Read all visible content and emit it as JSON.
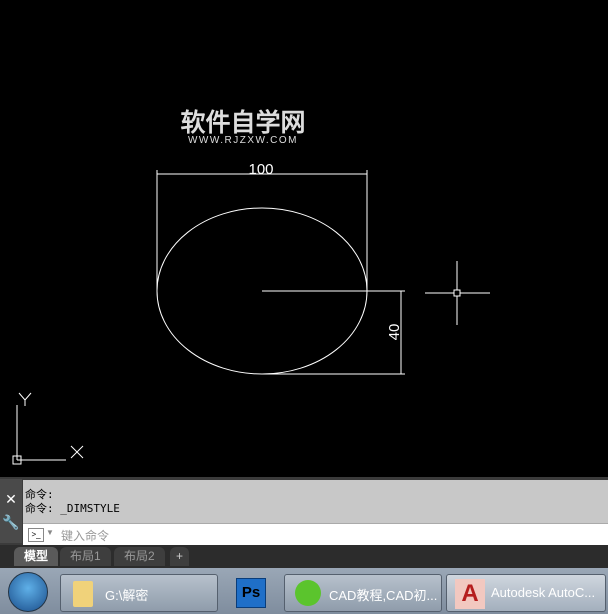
{
  "drawing": {
    "watermark_title": "软件自学网",
    "watermark_url": "WWW.RJZXW.COM",
    "dim_horizontal": "100",
    "dim_vertical": "40",
    "ucs_x": "X",
    "ucs_y": "Y"
  },
  "command": {
    "history": [
      "命令:",
      "命令: _DIMSTYLE"
    ],
    "placeholder": "键入命令"
  },
  "tabs": [
    {
      "label": "模型",
      "active": true
    },
    {
      "label": "布局1"
    },
    {
      "label": "布局2"
    },
    {
      "label": "+"
    }
  ],
  "taskbar": {
    "items": [
      {
        "label": "G:\\解密",
        "icon": "folder-icon"
      },
      {
        "label": "",
        "icon": "photoshop-icon",
        "icon_text": "Ps"
      },
      {
        "label": "CAD教程,CAD初...",
        "icon": "ie-browser-icon"
      },
      {
        "label": "Autodesk AutoC...",
        "icon": "autocad-icon",
        "icon_text": "A"
      }
    ]
  }
}
